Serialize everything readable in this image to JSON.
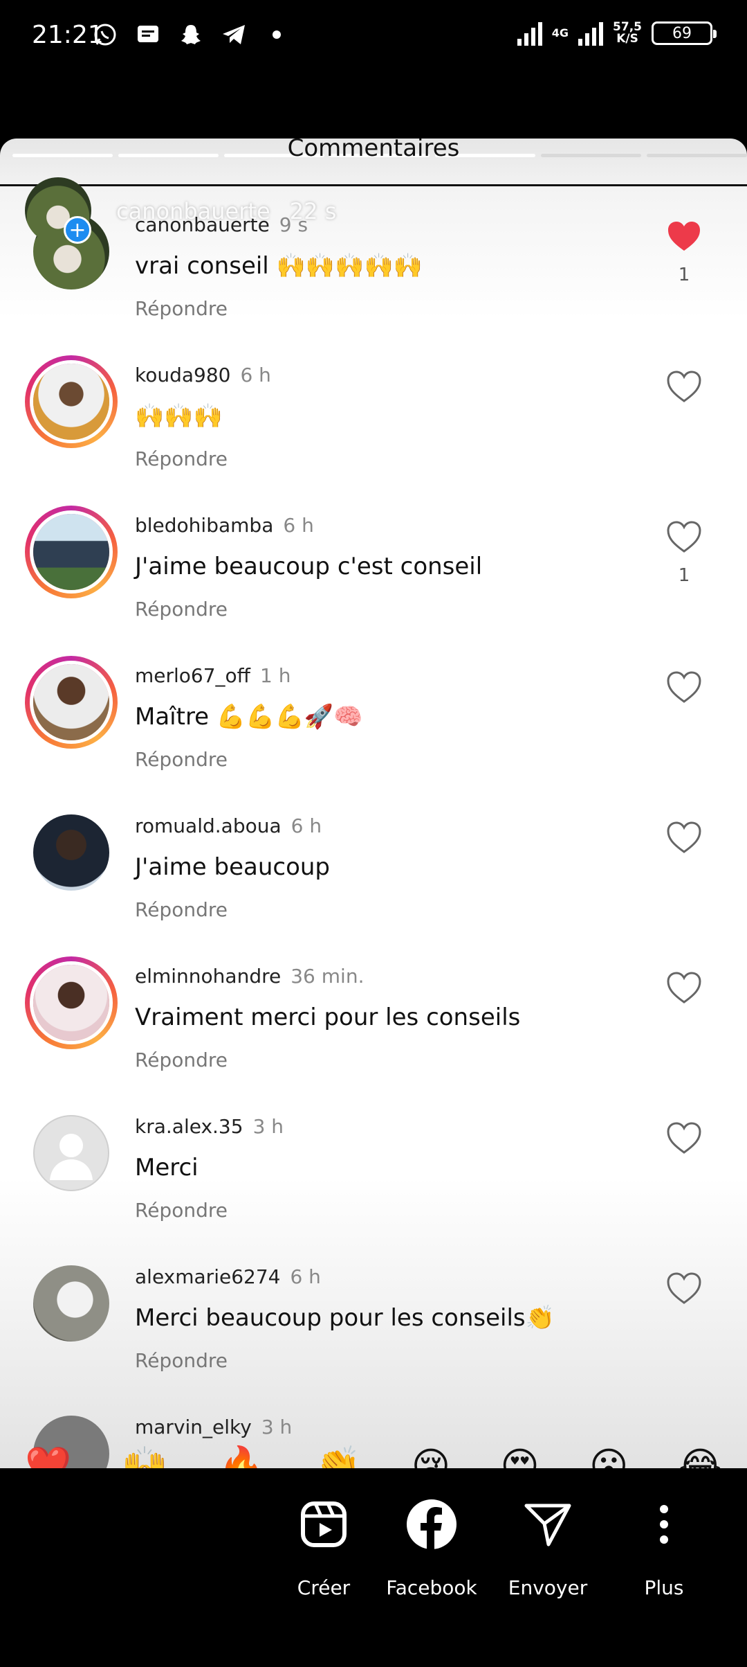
{
  "status_bar": {
    "time": "21:21",
    "network": "4G",
    "speed_value": "57,5",
    "speed_unit": "K/S",
    "battery": "69"
  },
  "sheet": {
    "title": "Commentaires",
    "overlay_username": "canonbauerte",
    "overlay_time": "22 s"
  },
  "comments": [
    {
      "username": "canonbauerte",
      "time": "9 s",
      "text": "vrai conseil 🙌🙌🙌🙌🙌",
      "reply": "Répondre",
      "likes": "1",
      "liked": true
    },
    {
      "username": "kouda980",
      "time": "6 h",
      "text": "🙌🙌🙌",
      "reply": "Répondre",
      "likes": "",
      "liked": false
    },
    {
      "username": "bledohibamba",
      "time": "6 h",
      "text": "J'aime beaucoup c'est conseil",
      "reply": "Répondre",
      "likes": "1",
      "liked": false
    },
    {
      "username": "merlo67_off",
      "time": "1 h",
      "text": "Maître 💪💪💪🚀🧠",
      "reply": "Répondre",
      "likes": "",
      "liked": false
    },
    {
      "username": "romuald.aboua",
      "time": "6 h",
      "text": "J'aime beaucoup",
      "reply": "Répondre",
      "likes": "",
      "liked": false
    },
    {
      "username": "elminnohandre",
      "time": "36 min.",
      "text": "Vraiment merci pour les conseils",
      "reply": "Répondre",
      "likes": "",
      "liked": false
    },
    {
      "username": "kra.alex.35",
      "time": "3 h",
      "text": "Merci",
      "reply": "Répondre",
      "likes": "",
      "liked": false
    },
    {
      "username": "alexmarie6274",
      "time": "6 h",
      "text": "Merci beaucoup pour les conseils👏",
      "reply": "Répondre",
      "likes": "",
      "liked": false
    },
    {
      "username": "marvin_elky",
      "time": "3 h",
      "text": "",
      "reply": "",
      "likes": "",
      "liked": false
    }
  ],
  "emoji_bar": [
    "❤️",
    "🙌",
    "🔥",
    "👏",
    "😢",
    "😍",
    "😮",
    "😂"
  ],
  "share": {
    "create": "Créer",
    "facebook": "Facebook",
    "send": "Envoyer",
    "more": "Plus"
  },
  "colors": {
    "like_red": "#ed3a4a",
    "ring_gradient": [
      "#c32aa3",
      "#f56040",
      "#fcaf45"
    ]
  }
}
